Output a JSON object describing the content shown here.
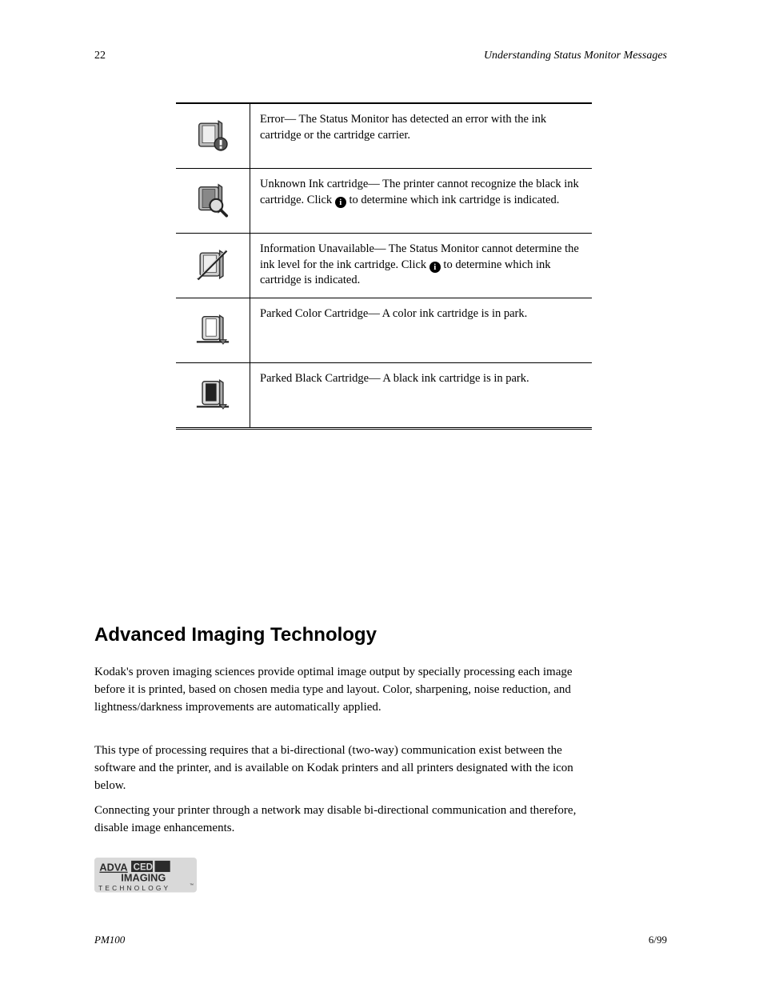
{
  "header": {
    "page_number": "22",
    "section_title": "Understanding Status Monitor Messages"
  },
  "rows": [
    {
      "icon": "printer-error-icon",
      "name": "Error",
      "desc": "— The Status Monitor has detected an error with the ink cartridge or the cartridge carrier."
    },
    {
      "icon": "printer-magnify-icon",
      "name": "Unknown Ink cartridge",
      "desc": "— The printer cannot recognize the black ink cartridge. Click ",
      "inline_info": true,
      "desc_after": " to determine which ink cartridge is indicated."
    },
    {
      "icon": "printer-unavailable-icon",
      "name": "Information Unavailable",
      "desc": "— The Status Monitor cannot determine the ink level for the ink cartridge. Click ",
      "inline_info": true,
      "desc_after": " to determine which ink cartridge is indicated."
    },
    {
      "icon": "printer-park-color-icon",
      "name": "Parked Color Cartridge",
      "desc": "— A color ink cartridge is in park."
    },
    {
      "icon": "printer-park-black-icon",
      "name": "Parked Black Cartridge",
      "desc": "— A black ink cartridge is in park."
    }
  ],
  "ait": {
    "heading": "Advanced Imaging Technology",
    "p1": "Kodak's proven imaging sciences provide optimal image output by specially processing each image before it is printed, based on chosen media type and layout. Color, sharpening, noise reduction, and lightness/darkness improvements are automatically applied.",
    "p2": "This type of processing requires that a bi-directional (two-way) communication exist between the software and the printer, and is available on Kodak printers and all printers designated with the icon below.",
    "p3": "Connecting your printer through a network may disable bi-directional communication and therefore, disable image enhancements."
  },
  "footer": {
    "model": "PM100",
    "date": "6/99"
  }
}
